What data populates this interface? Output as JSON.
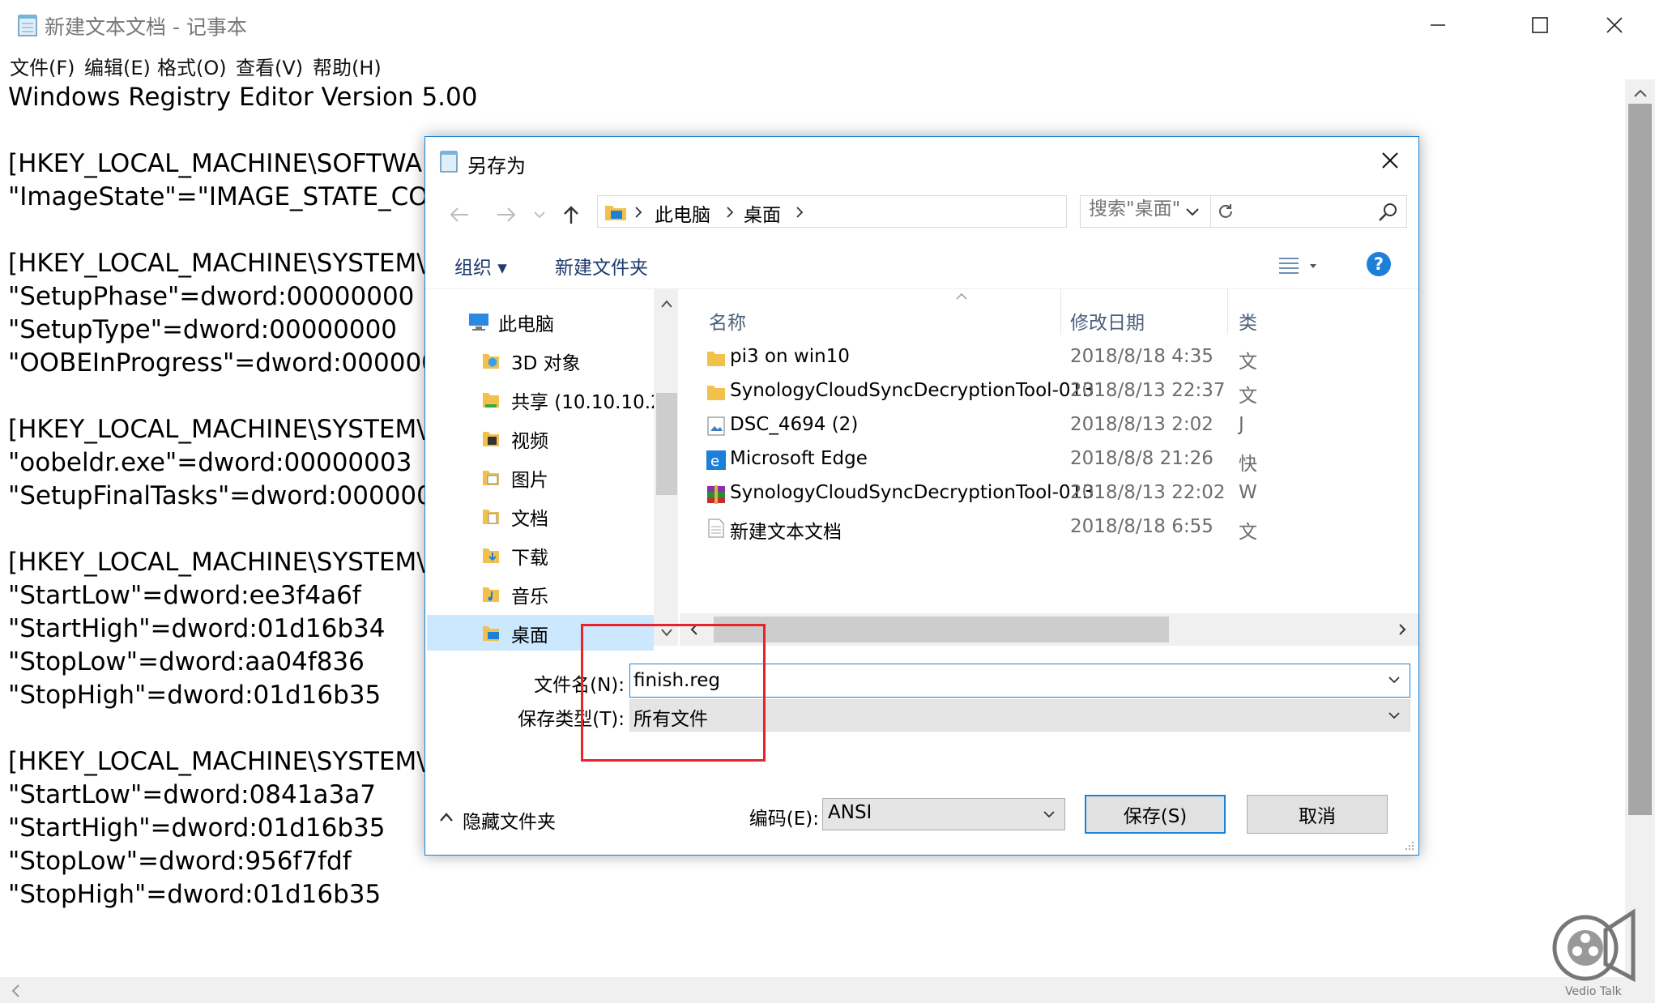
{
  "notepad": {
    "title": "新建文本文档 - 记事本",
    "menu": [
      "文件(F)",
      "编辑(E)",
      "格式(O)",
      "查看(V)",
      "帮助(H)"
    ],
    "content": "Windows Registry Editor Version 5.00\n\n[HKEY_LOCAL_MACHINE\\SOFTWA\n\"ImageState\"=\"IMAGE_STATE_CO\n\n[HKEY_LOCAL_MACHINE\\SYSTEM\\\n\"SetupPhase\"=dword:00000000\n\"SetupType\"=dword:00000000\n\"OOBEInProgress\"=dword:000000\n\n[HKEY_LOCAL_MACHINE\\SYSTEM\\\n\"oobeldr.exe\"=dword:00000003\n\"SetupFinalTasks\"=dword:000000\n\n[HKEY_LOCAL_MACHINE\\SYSTEM\\\n\"StartLow\"=dword:ee3f4a6f\n\"StartHigh\"=dword:01d16b34\n\"StopLow\"=dword:aa04f836\n\"StopHigh\"=dword:01d16b35\n\n[HKEY_LOCAL_MACHINE\\SYSTEM\\\n\"StartLow\"=dword:0841a3a7\n\"StartHigh\"=dword:01d16b35\n\"StopLow\"=dword:956f7fdf\n\"StopHigh\"=dword:01d16b35"
  },
  "dialog": {
    "title": "另存为",
    "breadcrumb": [
      "此电脑",
      "桌面"
    ],
    "search_placeholder": "搜索\"桌面\"",
    "toolbar": {
      "organize": "组织 ▾",
      "new_folder": "新建文件夹"
    },
    "nav_items": [
      {
        "label": "此电脑",
        "icon": "computer-icon"
      },
      {
        "label": "3D 对象",
        "icon": "3d-objects-icon"
      },
      {
        "label": "共享 (10.10.10.2",
        "icon": "network-share-icon"
      },
      {
        "label": "视频",
        "icon": "video-folder-icon"
      },
      {
        "label": "图片",
        "icon": "pictures-folder-icon"
      },
      {
        "label": "文档",
        "icon": "documents-folder-icon"
      },
      {
        "label": "下载",
        "icon": "downloads-folder-icon"
      },
      {
        "label": "音乐",
        "icon": "music-folder-icon"
      },
      {
        "label": "桌面",
        "icon": "desktop-folder-icon",
        "selected": true
      }
    ],
    "columns": {
      "name": "名称",
      "date": "修改日期",
      "type": "类"
    },
    "files": [
      {
        "name": "pi3 on win10",
        "date": "2018/8/18 4:35",
        "type": "文",
        "icon": "folder-icon"
      },
      {
        "name": "SynologyCloudSyncDecryptionTool-013",
        "date": "2018/8/13 22:37",
        "type": "文",
        "icon": "folder-icon"
      },
      {
        "name": "DSC_4694 (2)",
        "date": "2018/8/13 2:02",
        "type": "J",
        "icon": "image-file-icon"
      },
      {
        "name": "Microsoft Edge",
        "date": "2018/8/8 21:26",
        "type": "快",
        "icon": "edge-icon"
      },
      {
        "name": "SynologyCloudSyncDecryptionTool-013",
        "date": "2018/8/13 22:02",
        "type": "W",
        "icon": "winrar-archive-icon"
      },
      {
        "name": "新建文本文档",
        "date": "2018/8/18 6:55",
        "type": "文",
        "icon": "text-file-icon"
      }
    ],
    "filename_label": "文件名(N):",
    "filename_value": "finish.reg",
    "filetype_label": "保存类型(T):",
    "filetype_value": "所有文件",
    "encoding_label": "编码(E):",
    "encoding_value": "ANSI",
    "hide_folders": "隐藏文件夹",
    "save_button": "保存(S)",
    "cancel_button": "取消"
  },
  "watermark": {
    "text": "Vedio Talk"
  },
  "colors": {
    "accent": "#1883d7",
    "annotation": "#e8232a",
    "help": "#1e7fd8"
  }
}
